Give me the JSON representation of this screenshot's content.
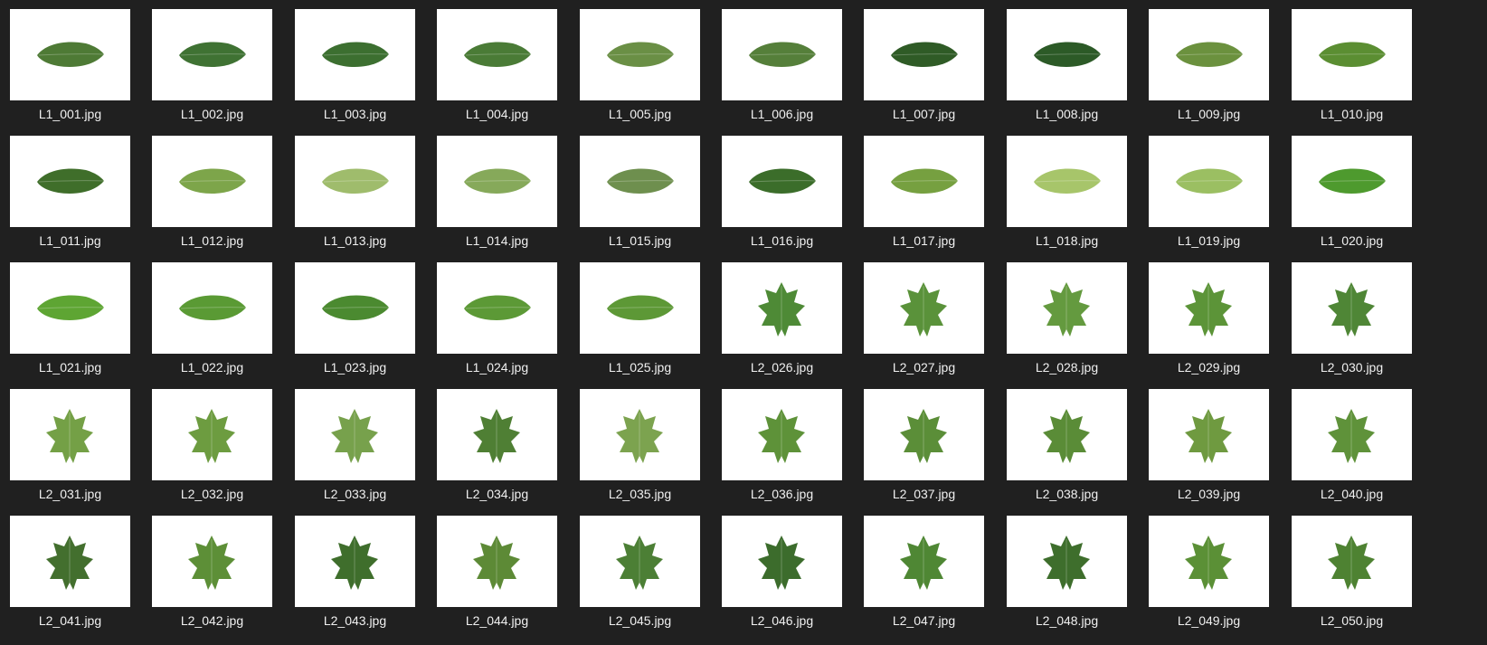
{
  "view": {
    "background": "#202020",
    "label_color": "#f0f0f0",
    "thumbnail_background": "#ffffff"
  },
  "files": [
    {
      "name": "L1_001.jpg",
      "leaf": "lanceolate",
      "color": "#4e7a35"
    },
    {
      "name": "L1_002.jpg",
      "leaf": "lanceolate",
      "color": "#3f7233"
    },
    {
      "name": "L1_003.jpg",
      "leaf": "lanceolate",
      "color": "#3c6f30"
    },
    {
      "name": "L1_004.jpg",
      "leaf": "lanceolate",
      "color": "#4a7b36"
    },
    {
      "name": "L1_005.jpg",
      "leaf": "lanceolate",
      "color": "#6a8f45"
    },
    {
      "name": "L1_006.jpg",
      "leaf": "lanceolate",
      "color": "#557f3a"
    },
    {
      "name": "L1_007.jpg",
      "leaf": "lanceolate",
      "color": "#2f5b26"
    },
    {
      "name": "L1_008.jpg",
      "leaf": "lanceolate",
      "color": "#2c5a27"
    },
    {
      "name": "L1_009.jpg",
      "leaf": "lanceolate",
      "color": "#6b913e"
    },
    {
      "name": "L1_010.jpg",
      "leaf": "lanceolate",
      "color": "#5b8e32"
    },
    {
      "name": "L1_011.jpg",
      "leaf": "lanceolate",
      "color": "#3f6e2a"
    },
    {
      "name": "L1_012.jpg",
      "leaf": "lanceolate",
      "color": "#7da54a"
    },
    {
      "name": "L1_013.jpg",
      "leaf": "lanceolate",
      "color": "#9fbc6c"
    },
    {
      "name": "L1_014.jpg",
      "leaf": "lanceolate",
      "color": "#86a95a"
    },
    {
      "name": "L1_015.jpg",
      "leaf": "lanceolate",
      "color": "#6e8f4e"
    },
    {
      "name": "L1_016.jpg",
      "leaf": "lanceolate",
      "color": "#3b6d2a"
    },
    {
      "name": "L1_017.jpg",
      "leaf": "lanceolate",
      "color": "#76a040"
    },
    {
      "name": "L1_018.jpg",
      "leaf": "lanceolate",
      "color": "#a7c56a"
    },
    {
      "name": "L1_019.jpg",
      "leaf": "lanceolate",
      "color": "#9bbf62"
    },
    {
      "name": "L1_020.jpg",
      "leaf": "lanceolate",
      "color": "#4e9a2e"
    },
    {
      "name": "L1_021.jpg",
      "leaf": "lanceolate",
      "color": "#5ea533"
    },
    {
      "name": "L1_022.jpg",
      "leaf": "lanceolate",
      "color": "#5a9a34"
    },
    {
      "name": "L1_023.jpg",
      "leaf": "lanceolate",
      "color": "#4b8a30"
    },
    {
      "name": "L1_024.jpg",
      "leaf": "lanceolate",
      "color": "#5c9936"
    },
    {
      "name": "L1_025.jpg",
      "leaf": "lanceolate",
      "color": "#5d9836"
    },
    {
      "name": "L2_026.jpg",
      "leaf": "lobed",
      "color": "#4e8a36"
    },
    {
      "name": "L2_027.jpg",
      "leaf": "lobed",
      "color": "#5a923a"
    },
    {
      "name": "L2_028.jpg",
      "leaf": "lobed",
      "color": "#649a3f"
    },
    {
      "name": "L2_029.jpg",
      "leaf": "lobed",
      "color": "#5c9438"
    },
    {
      "name": "L2_030.jpg",
      "leaf": "lobed",
      "color": "#4f8636"
    },
    {
      "name": "L2_031.jpg",
      "leaf": "lobed",
      "color": "#74a046"
    },
    {
      "name": "L2_032.jpg",
      "leaf": "lobed",
      "color": "#6d9c40"
    },
    {
      "name": "L2_033.jpg",
      "leaf": "lobed",
      "color": "#77a14c"
    },
    {
      "name": "L2_034.jpg",
      "leaf": "lobed",
      "color": "#4f7f34"
    },
    {
      "name": "L2_035.jpg",
      "leaf": "lobed",
      "color": "#7ca34f"
    },
    {
      "name": "L2_036.jpg",
      "leaf": "lobed",
      "color": "#5e9239"
    },
    {
      "name": "L2_037.jpg",
      "leaf": "lobed",
      "color": "#5b8e38"
    },
    {
      "name": "L2_038.jpg",
      "leaf": "lobed",
      "color": "#5a8c37"
    },
    {
      "name": "L2_039.jpg",
      "leaf": "lobed",
      "color": "#6f9a40"
    },
    {
      "name": "L2_040.jpg",
      "leaf": "lobed",
      "color": "#5f923a"
    },
    {
      "name": "L2_041.jpg",
      "leaf": "lobed",
      "color": "#436f2e"
    },
    {
      "name": "L2_042.jpg",
      "leaf": "lobed",
      "color": "#5d8f37"
    },
    {
      "name": "L2_043.jpg",
      "leaf": "lobed",
      "color": "#3f6e2c"
    },
    {
      "name": "L2_044.jpg",
      "leaf": "lobed",
      "color": "#5d8a36"
    },
    {
      "name": "L2_045.jpg",
      "leaf": "lobed",
      "color": "#4c7f35"
    },
    {
      "name": "L2_046.jpg",
      "leaf": "lobed",
      "color": "#3c6c2c"
    },
    {
      "name": "L2_047.jpg",
      "leaf": "lobed",
      "color": "#4f8734"
    },
    {
      "name": "L2_048.jpg",
      "leaf": "lobed",
      "color": "#3e6e2c"
    },
    {
      "name": "L2_049.jpg",
      "leaf": "lobed",
      "color": "#5b9036"
    },
    {
      "name": "L2_050.jpg",
      "leaf": "lobed",
      "color": "#4e8232"
    }
  ]
}
